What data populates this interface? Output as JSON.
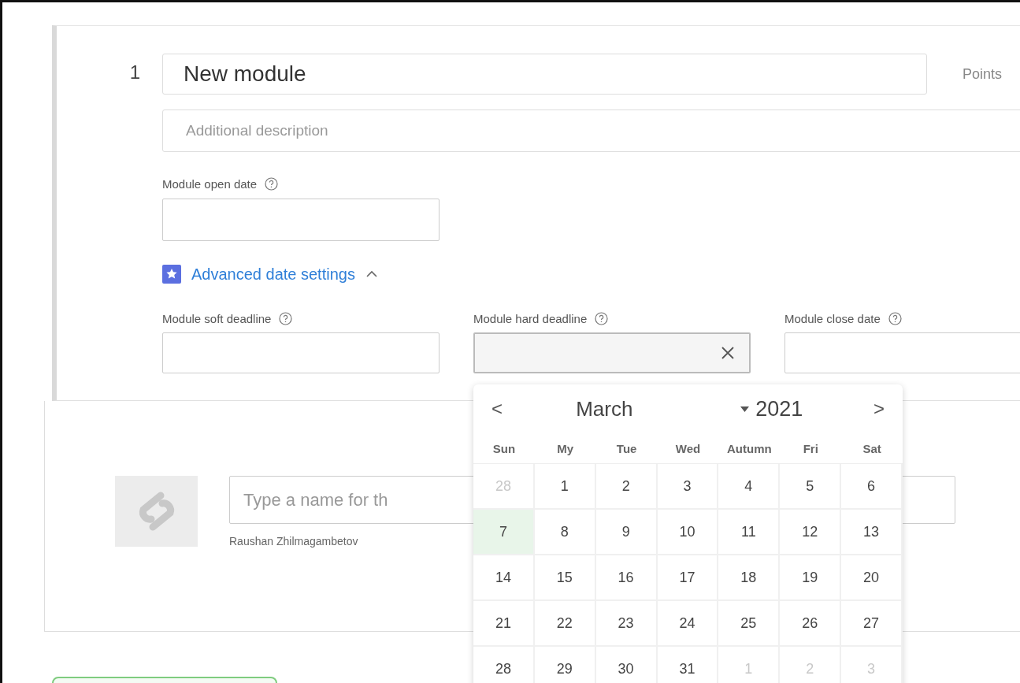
{
  "module": {
    "number": "1",
    "title": "New module",
    "points_label": "Points",
    "description_placeholder": "Additional description",
    "open_date": {
      "label": "Module open date"
    },
    "advanced": {
      "label": "Advanced date settings",
      "expanded": true
    },
    "deadlines": [
      {
        "label": "Module soft deadline",
        "clearable": false
      },
      {
        "label": "Module hard deadline",
        "clearable": true
      },
      {
        "label": "Module close date",
        "clearable": false
      }
    ]
  },
  "item": {
    "name_placeholder": "Type a name for th",
    "author": "Raushan Zhilmagambetov"
  },
  "calendar": {
    "prev": "<",
    "month": "March",
    "year": "2021",
    "next": ">",
    "weekdays": [
      "Sun",
      "My",
      "Tue",
      "Wed",
      "Autumn",
      "Fri",
      "Sat"
    ],
    "weeks": [
      [
        {
          "day": "28",
          "outside": true,
          "selected": false
        },
        {
          "day": "1",
          "outside": false,
          "selected": false
        },
        {
          "day": "2",
          "outside": false,
          "selected": false
        },
        {
          "day": "3",
          "outside": false,
          "selected": false
        },
        {
          "day": "4",
          "outside": false,
          "selected": false
        },
        {
          "day": "5",
          "outside": false,
          "selected": false
        },
        {
          "day": "6",
          "outside": false,
          "selected": false
        }
      ],
      [
        {
          "day": "7",
          "outside": false,
          "selected": true
        },
        {
          "day": "8",
          "outside": false,
          "selected": false
        },
        {
          "day": "9",
          "outside": false,
          "selected": false
        },
        {
          "day": "10",
          "outside": false,
          "selected": false
        },
        {
          "day": "11",
          "outside": false,
          "selected": false
        },
        {
          "day": "12",
          "outside": false,
          "selected": false
        },
        {
          "day": "13",
          "outside": false,
          "selected": false
        }
      ],
      [
        {
          "day": "14",
          "outside": false,
          "selected": false
        },
        {
          "day": "15",
          "outside": false,
          "selected": false
        },
        {
          "day": "16",
          "outside": false,
          "selected": false
        },
        {
          "day": "17",
          "outside": false,
          "selected": false
        },
        {
          "day": "18",
          "outside": false,
          "selected": false
        },
        {
          "day": "19",
          "outside": false,
          "selected": false
        },
        {
          "day": "20",
          "outside": false,
          "selected": false
        }
      ],
      [
        {
          "day": "21",
          "outside": false,
          "selected": false
        },
        {
          "day": "22",
          "outside": false,
          "selected": false
        },
        {
          "day": "23",
          "outside": false,
          "selected": false
        },
        {
          "day": "24",
          "outside": false,
          "selected": false
        },
        {
          "day": "25",
          "outside": false,
          "selected": false
        },
        {
          "day": "26",
          "outside": false,
          "selected": false
        },
        {
          "day": "27",
          "outside": false,
          "selected": false
        }
      ],
      [
        {
          "day": "28",
          "outside": false,
          "selected": false
        },
        {
          "day": "29",
          "outside": false,
          "selected": false
        },
        {
          "day": "30",
          "outside": false,
          "selected": false
        },
        {
          "day": "31",
          "outside": false,
          "selected": false
        },
        {
          "day": "1",
          "outside": true,
          "selected": false
        },
        {
          "day": "2",
          "outside": true,
          "selected": false
        },
        {
          "day": "3",
          "outside": true,
          "selected": false
        }
      ]
    ]
  }
}
